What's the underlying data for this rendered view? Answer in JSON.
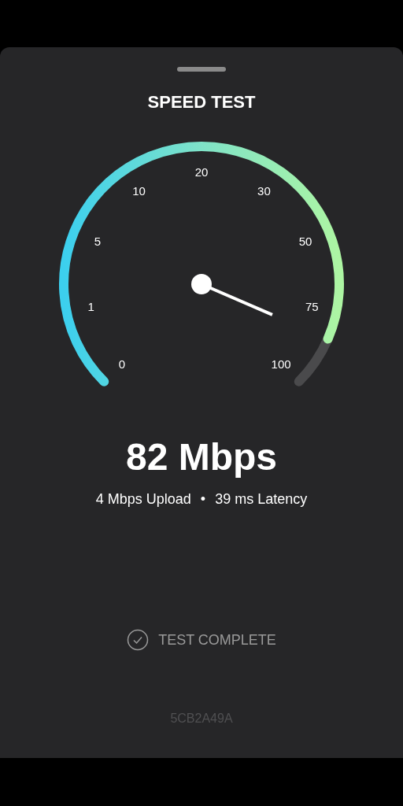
{
  "title": "SPEED TEST",
  "gauge": {
    "scale_labels": [
      "0",
      "1",
      "5",
      "10",
      "20",
      "30",
      "50",
      "75",
      "100"
    ]
  },
  "speed": "82 Mbps",
  "details": {
    "upload": "4 Mbps Upload",
    "separator": "•",
    "latency": "39 ms Latency"
  },
  "status": {
    "text": "TEST COMPLETE",
    "complete": true
  },
  "code": "5CB2A49A"
}
